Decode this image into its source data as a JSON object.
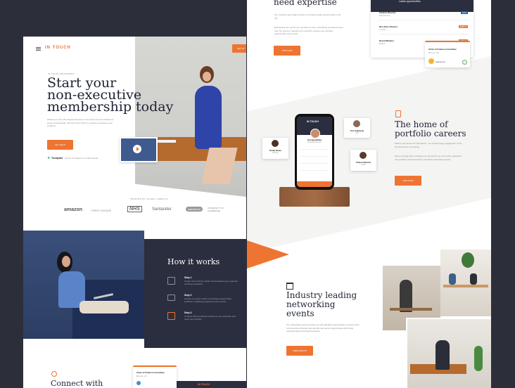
{
  "left": {
    "brand": "IN TOUCH",
    "header_button": "GET IN",
    "eyebrow": "IN TOUCH NETWORKS",
    "hero_title": [
      "Start your",
      "non-executive",
      "membership today"
    ],
    "hero_body": "Welcome to the UK's largest Non-Exec community, the best solution for senior professionals, directors and CXO's to network and acquire new positions.",
    "hero_button": "GET HELP",
    "trust_brand": "Trustpilot",
    "trust_text": "4.8 out of 5 based on 2,784 reviews",
    "trusted_by": "TRUSTED BY 30,000+ USERS IN",
    "logos": [
      "amazon",
      "FIRST CHOICE",
      "NHS",
      "Santander",
      "salesforce",
      "UNIVERSITY OF CAMBRIDGE"
    ],
    "how_title": "How it works",
    "steps": [
      {
        "title": "Step 1",
        "text": "Create Your InTouch profile and showcase your expertise to hiring companies"
      },
      {
        "title": "Step 2",
        "text": "Access our online, listen to the latest opportunities, webinars, coaching programmes and events"
      },
      {
        "title": "Step 3",
        "text": "Connect with companies looking for your expertise and grow your portfolio"
      }
    ],
    "connect_title": "Connect with",
    "mini_card_title": "Chair of Finance Committee",
    "mini_card_sub": "Belvoir, UK",
    "mini_brand": "IN TOUCH"
  },
  "right": {
    "top_title": "need expertise",
    "top_body_1": "Our members get instant access to the latest board opportunities in the UK.",
    "top_body_2": "Businesses can recruit our members for free, eliminating recruitment fees from the process. Meaning our members receive new, lucrative opportunities every week.",
    "top_button": "JOIN NOW",
    "dash_header": "Latest opportunities",
    "dash_rows": [
      {
        "title": "Finance Director",
        "sub": "Manchester",
        "tag": "NHS"
      },
      {
        "title": "Non-Exec Director",
        "sub": "London",
        "tag": "APPLY"
      },
      {
        "title": "Board Member",
        "sub": "Bristol",
        "tag": "APPLY"
      }
    ],
    "popup_title": "Chair of Finance Committee",
    "popup_sub": "Belvoir, UK",
    "popup_item": "Salesforce",
    "phone_brand": "IN TOUCH",
    "phone_name": "George Bailey",
    "phone_role": "Financial Director",
    "bubbles": [
      {
        "name": "Emily Rowe",
        "role": "Director"
      },
      {
        "name": "Tom Edwards",
        "role": "CFO"
      },
      {
        "name": "Chanel Benitez",
        "role": "Chair"
      }
    ],
    "portfolio_title": [
      "The home of",
      "portfolio careers"
    ],
    "portfolio_body_1": "Built by Non-Execs for Non-Execs - our portal brings engagement to the Non-Executive community.",
    "portfolio_body_2": "Every meeting that is created upon Purely for our community, approach new positions and be invited to the latest networking events.",
    "portfolio_button": "JOIN NOW",
    "events_title": [
      "Industry leading",
      "networking",
      "events"
    ],
    "events_body": "Our networking events provide you with valuable opportunities to connect with non-executive directors and identify new sector opportunities with fellow professionals and hiring businesses.",
    "events_button": "VIEW EVENTS"
  },
  "colors": {
    "accent": "#ee7431",
    "navy": "#2b2e3e",
    "bg": "#2c2f3a"
  }
}
